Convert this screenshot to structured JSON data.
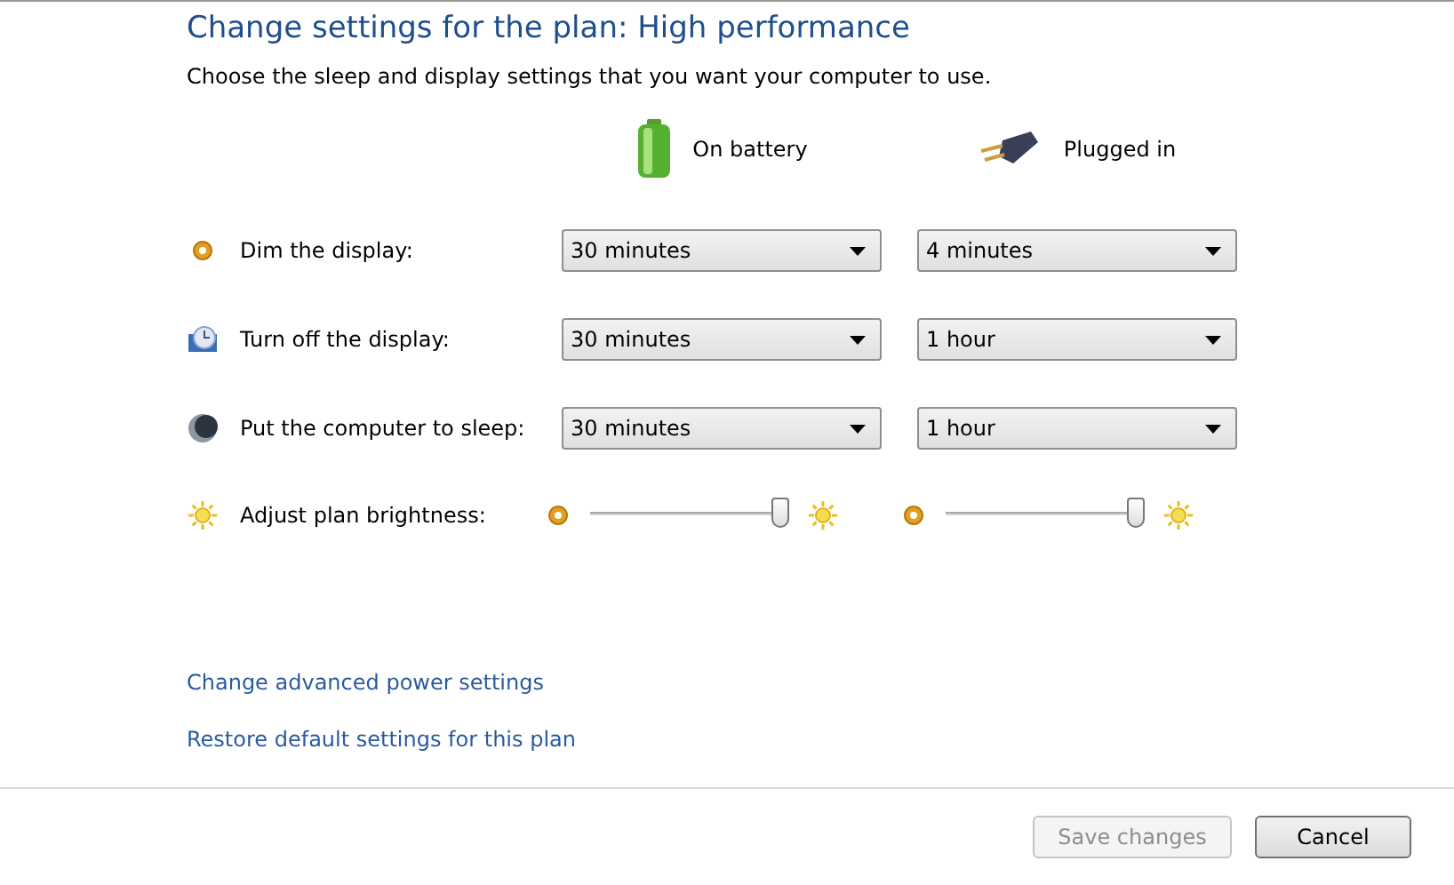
{
  "title": "Change settings for the plan: High performance",
  "subtitle": "Choose the sleep and display settings that you want your computer to use.",
  "columns": [
    {
      "kind": "battery",
      "label": "On battery"
    },
    {
      "kind": "plugged",
      "label": "Plugged in"
    }
  ],
  "settings": [
    {
      "kind": "dropdown",
      "label": "Dim the display:",
      "values": [
        "30 minutes",
        "4 minutes"
      ]
    },
    {
      "kind": "dropdown",
      "label": "Turn off the display:",
      "values": [
        "30 minutes",
        "1 hour"
      ]
    },
    {
      "kind": "dropdown",
      "label": "Put the computer to sleep:",
      "values": [
        "30 minutes",
        "1 hour"
      ]
    },
    {
      "kind": "slider",
      "label": "Adjust plan brightness:",
      "levels": [
        {
          "level": 0.97
        },
        {
          "level": 0.97
        }
      ]
    }
  ],
  "links": [
    "Change advanced power settings",
    "Restore default settings for this plan"
  ],
  "buttons": [
    {
      "label": "Save changes",
      "disabled": true
    },
    {
      "label": "Cancel",
      "disabled": false
    }
  ]
}
